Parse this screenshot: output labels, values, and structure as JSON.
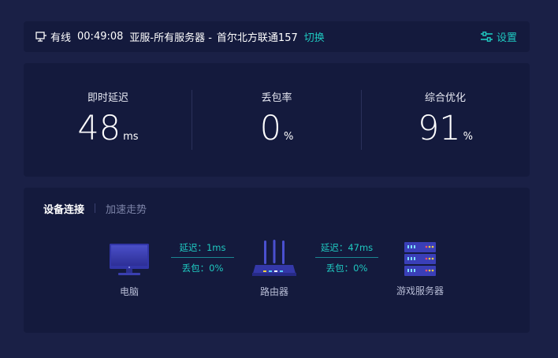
{
  "topbar": {
    "connection_status": "有线",
    "timer": "00:49:08",
    "server": "亚服-所有服务器 -",
    "node": "首尔北方联通157",
    "switch_label": "切换",
    "settings_label": "设置"
  },
  "stats": [
    {
      "label": "即时延迟",
      "value": "48",
      "unit": "ms"
    },
    {
      "label": "丢包率",
      "value": "0",
      "unit": "%"
    },
    {
      "label": "综合优化",
      "value": "91",
      "unit": "%"
    }
  ],
  "tabs": {
    "active": "设备连接",
    "inactive": "加速走势"
  },
  "devices": {
    "pc": "电脑",
    "router": "路由器",
    "server": "游戏服务器"
  },
  "links": [
    {
      "latency": "延迟：1ms",
      "loss": "丢包：0%"
    },
    {
      "latency": "延迟：47ms",
      "loss": "丢包：0%"
    }
  ],
  "colors": {
    "accent": "#1fc8c0",
    "background": "#1a2046",
    "card": "#141a3d"
  }
}
